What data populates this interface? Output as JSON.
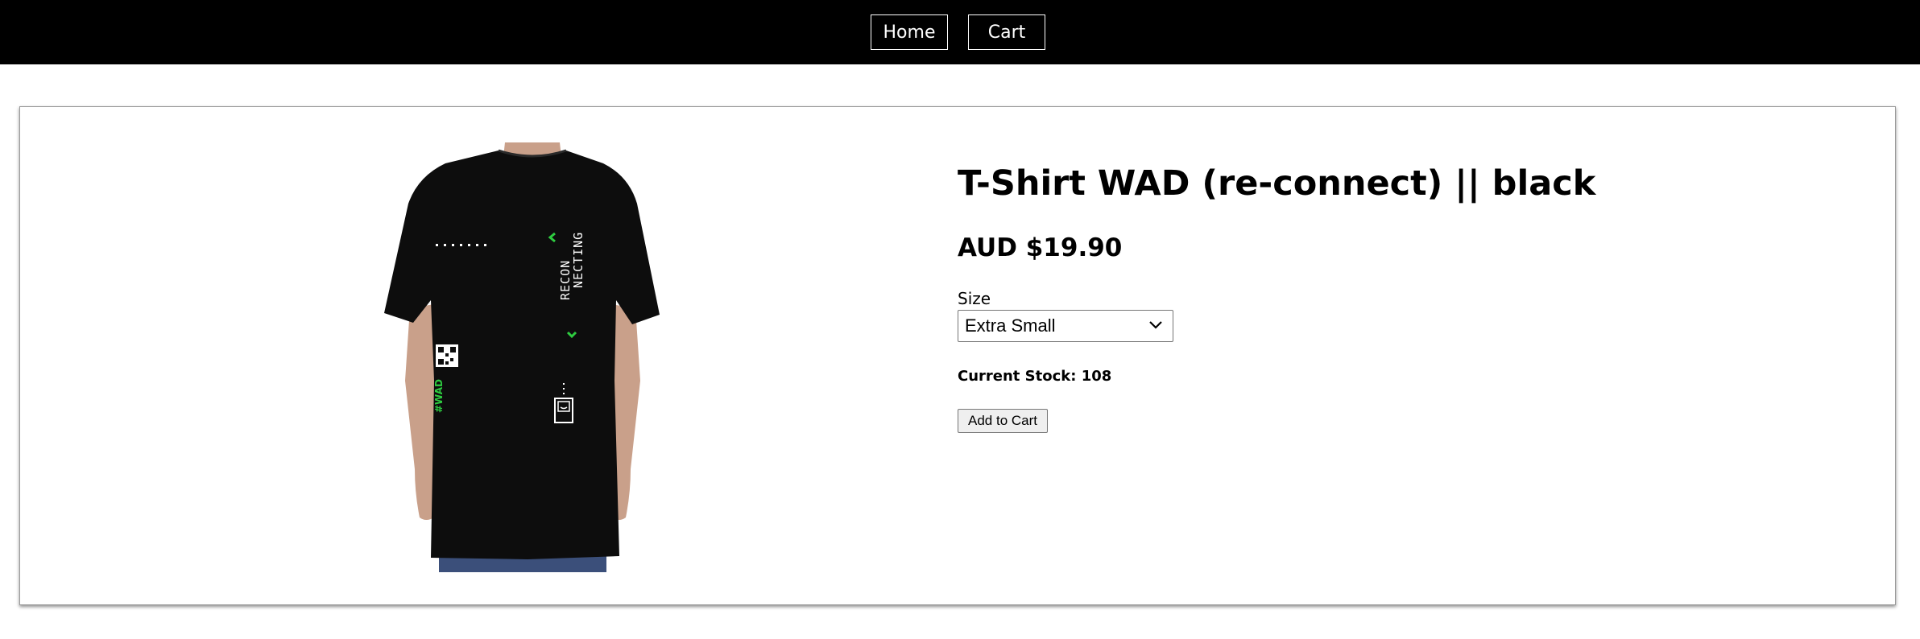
{
  "nav": {
    "home_label": "Home",
    "cart_label": "Cart"
  },
  "product": {
    "title": "T-Shirt WAD (re-connect) || black",
    "price": "AUD $19.90",
    "size_label": "Size",
    "size_selected": "Extra Small",
    "stock_text": "Current Stock: 108",
    "add_to_cart_label": "Add to Cart",
    "image": {
      "subject": "black t-shirt back print",
      "print_text": "RECON NECTING",
      "logo_text": "WAD",
      "accent_color": "#2ecc40"
    }
  },
  "colors": {
    "topbar": "#000000",
    "background": "#ffffff",
    "shirt": "#0d0d0d",
    "skin": "#c9a08a",
    "jeans": "#3b4f7a"
  }
}
